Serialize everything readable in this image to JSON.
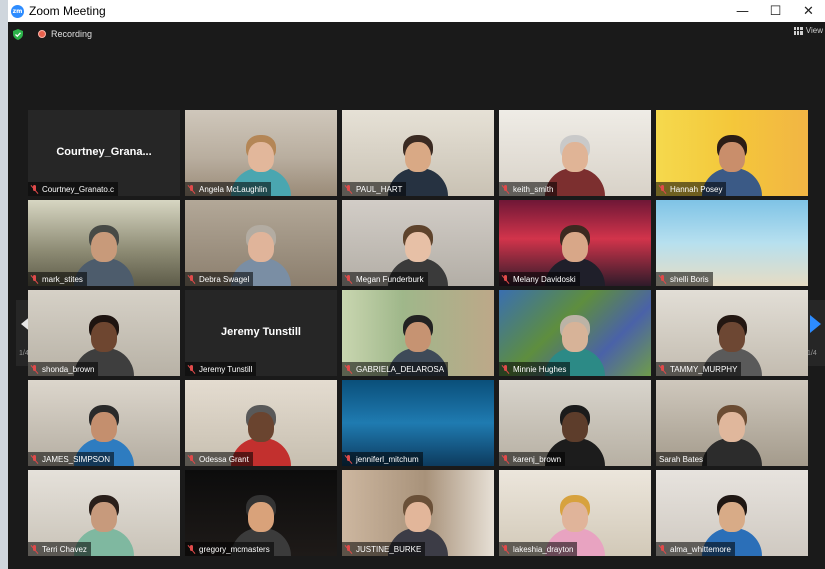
{
  "window": {
    "app_icon": "zoom-logo-icon",
    "logo_text": "zm",
    "title": "Zoom Meeting",
    "minimize": "—",
    "maximize": "☐",
    "close": "✕"
  },
  "toolbar": {
    "security_icon": "shield-check-icon",
    "recording_label": "Recording",
    "view_label": "View",
    "view_icon": "grid-icon"
  },
  "navigation": {
    "prev_icon": "chevron-left-icon",
    "next_icon": "chevron-right-icon",
    "page_left": "1/4",
    "page_right": "1/4",
    "arrow_color": "#2d8cff"
  },
  "colors": {
    "active_speaker_border": "#e4e36a",
    "mute_icon": "#e04a4a"
  },
  "participants": [
    {
      "name": "Courtney_Granato.c",
      "display_name": "Courtney_Grana...",
      "video": false,
      "muted": true
    },
    {
      "name": "Angela McLaughlin",
      "video": true,
      "muted": true
    },
    {
      "name": "PAUL_HART",
      "video": true,
      "muted": true
    },
    {
      "name": "keith_smith",
      "video": true,
      "muted": true
    },
    {
      "name": "Hannah Posey",
      "video": true,
      "muted": true
    },
    {
      "name": "mark_stites",
      "video": true,
      "muted": true
    },
    {
      "name": "Debra Swagel",
      "video": true,
      "muted": true
    },
    {
      "name": "Megan Funderburk",
      "video": true,
      "muted": true
    },
    {
      "name": "Melany Davidoski",
      "video": true,
      "muted": true
    },
    {
      "name": "shelli Boris",
      "video": true,
      "muted": true
    },
    {
      "name": "shonda_brown",
      "video": true,
      "muted": true
    },
    {
      "name": "Jeremy Tunstill",
      "display_name": "Jeremy Tunstill",
      "video": false,
      "muted": true
    },
    {
      "name": "GABRIELA_DELAROSA",
      "video": true,
      "muted": true
    },
    {
      "name": "Minnie Hughes",
      "video": true,
      "muted": true
    },
    {
      "name": "TAMMY_MURPHY",
      "video": true,
      "muted": true
    },
    {
      "name": "JAMES_SIMPSON",
      "video": true,
      "muted": true
    },
    {
      "name": "Odessa Grant",
      "video": true,
      "muted": true
    },
    {
      "name": "jenniferl_mitchum",
      "video": true,
      "muted": true
    },
    {
      "name": "karenj_brown",
      "video": true,
      "muted": true
    },
    {
      "name": "Sarah Bates",
      "video": true,
      "muted": false,
      "active_speaker": true
    },
    {
      "name": "Terri Chavez",
      "video": true,
      "muted": true
    },
    {
      "name": "gregory_mcmasters",
      "video": true,
      "muted": true
    },
    {
      "name": "JUSTINE_BURKE",
      "video": true,
      "muted": true
    },
    {
      "name": "lakeshia_drayton",
      "video": true,
      "muted": true
    },
    {
      "name": "alma_whittemore",
      "video": true,
      "muted": true
    }
  ]
}
